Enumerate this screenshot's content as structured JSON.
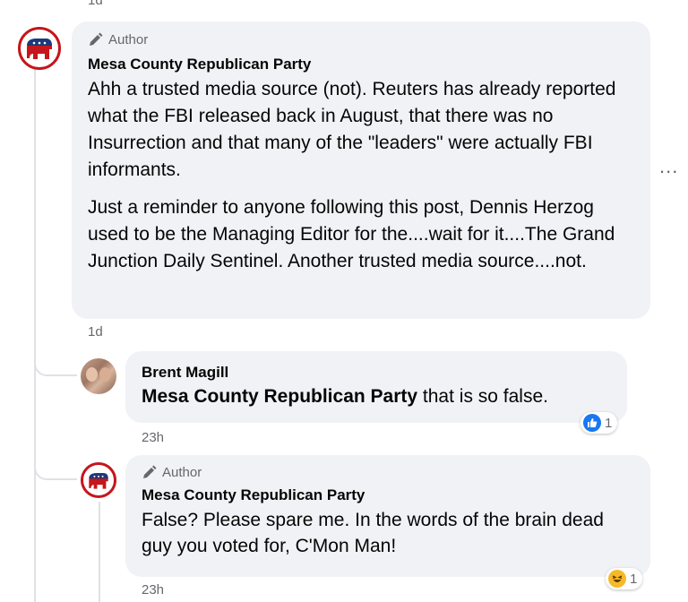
{
  "top_timestamp": "1d",
  "comment_main": {
    "badge_icon": "pencil-icon",
    "badge_label": "Author",
    "author": "Mesa County Republican Party",
    "paragraph_1": "Ahh a trusted media source (not). Reuters has already reported what the FBI released back in August, that there was no Insurrection and that many of the \"leaders\" were actually FBI informants.",
    "paragraph_2": "Just a reminder to anyone following this post, Dennis Herzog used to be the Managing Editor for the....wait for it....The Grand Junction Daily Sentinel. Another trusted media source....not.",
    "timestamp": "1d",
    "more_label": "..."
  },
  "reply_1": {
    "author": "Brent Magill",
    "mention": "Mesa County Republican Party",
    "text": " that is so false.",
    "timestamp": "23h",
    "reaction": {
      "icon": "like-icon",
      "count": "1",
      "color": "#1877f2"
    }
  },
  "reply_2": {
    "badge_icon": "pencil-icon",
    "badge_label": "Author",
    "author": "Mesa County Republican Party",
    "text": "False? Please spare me. In the words of the brain dead guy you voted for, C'Mon Man!",
    "timestamp": "23h",
    "reaction": {
      "icon": "laugh-emoji-icon",
      "count": "1"
    }
  },
  "colors": {
    "bubble": "#f0f2f5",
    "secondary_text": "#65676b",
    "gop_red": "#c4161c",
    "gop_blue": "#1a3a7a"
  }
}
